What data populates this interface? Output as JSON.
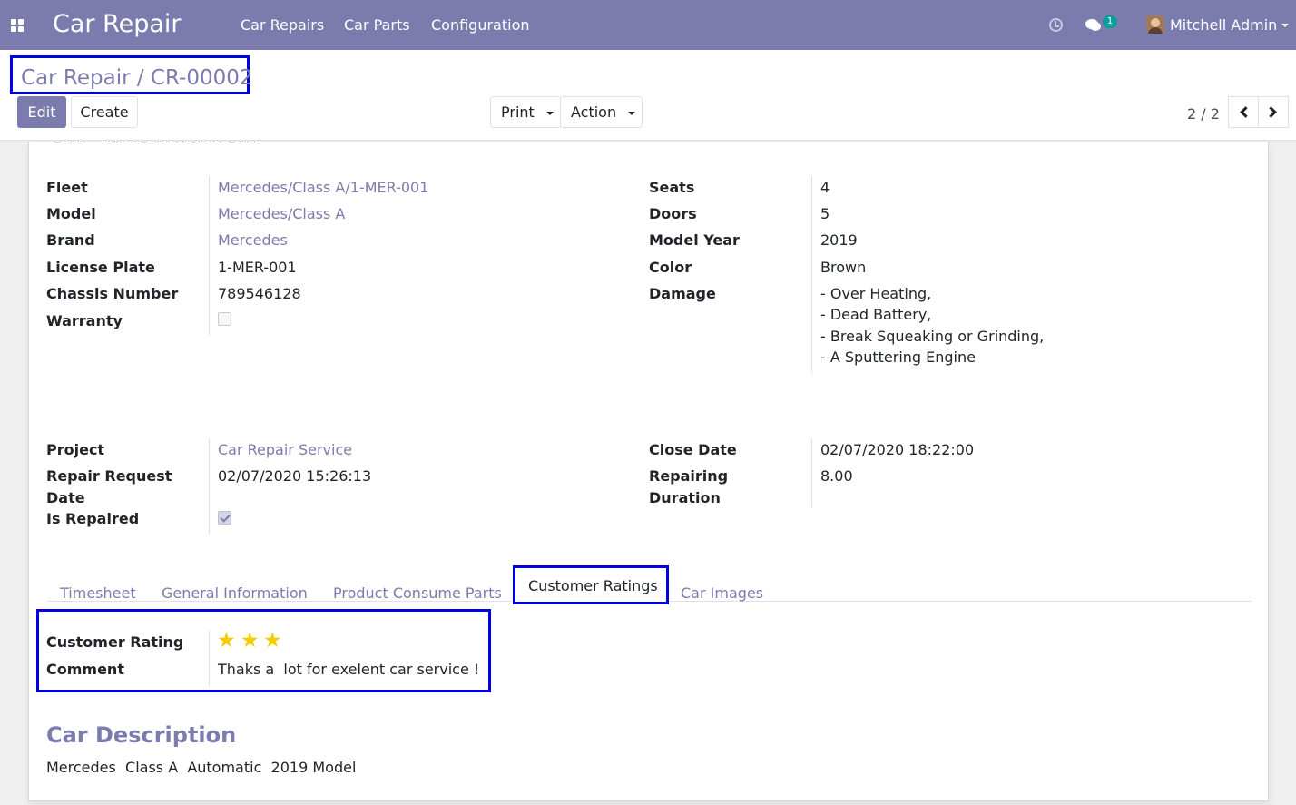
{
  "navbar": {
    "app_title": "Car Repair",
    "menu": [
      "Car Repairs",
      "Car Parts",
      "Configuration"
    ],
    "chat_count": "1",
    "user_name": "Mitchell Admin"
  },
  "control_panel": {
    "breadcrumb": "Car Repair / CR-00002",
    "edit_label": "Edit",
    "create_label": "Create",
    "print_label": "Print",
    "action_label": "Action",
    "pager": "2 / 2"
  },
  "form": {
    "section_heading": "Car Information",
    "left_fields": {
      "fleet": {
        "label": "Fleet",
        "value": "Mercedes/Class A/1-MER-001"
      },
      "model": {
        "label": "Model",
        "value": "Mercedes/Class A"
      },
      "brand": {
        "label": "Brand",
        "value": "Mercedes"
      },
      "license_plate": {
        "label": "License Plate",
        "value": "1-MER-001"
      },
      "chassis_number": {
        "label": "Chassis Number",
        "value": "789546128"
      },
      "warranty": {
        "label": "Warranty",
        "checked": false
      }
    },
    "right_fields": {
      "seats": {
        "label": "Seats",
        "value": "4"
      },
      "doors": {
        "label": "Doors",
        "value": "5"
      },
      "model_year": {
        "label": "Model Year",
        "value": "2019"
      },
      "color": {
        "label": "Color",
        "value": "Brown"
      },
      "damage": {
        "label": "Damage",
        "lines": [
          "- Over Heating,",
          "- Dead Battery,",
          "- Break Squeaking or Grinding,",
          "- A Sputtering Engine"
        ]
      }
    },
    "repair_left": {
      "project": {
        "label": "Project",
        "value": "Car Repair Service"
      },
      "request_date": {
        "label_line1": "Repair Request",
        "label_line2": "Date",
        "value": "02/07/2020 15:26:13"
      },
      "is_repaired": {
        "label": "Is Repaired",
        "checked": true
      }
    },
    "repair_right": {
      "close_date": {
        "label": "Close Date",
        "value": "02/07/2020 18:22:00"
      },
      "duration": {
        "label_line1": "Repairing",
        "label_line2": "Duration",
        "value": "8.00"
      }
    },
    "tabs": [
      "Timesheet",
      "General Information",
      "Product Consume Parts",
      "Customer Ratings",
      "Car Images"
    ],
    "active_tab": "Customer Ratings",
    "ratings": {
      "rating_label": "Customer Rating",
      "stars": 3,
      "comment_label": "Comment",
      "comment": "Thaks a  lot for exelent car service !"
    },
    "description": {
      "title": "Car Description",
      "text": "Mercedes  Class A  Automatic  2019 Model"
    }
  },
  "colors": {
    "brand": "#7c7bad",
    "highlight_box": "#0000e6",
    "star": "#f3cc00",
    "badge": "#00a09d"
  }
}
